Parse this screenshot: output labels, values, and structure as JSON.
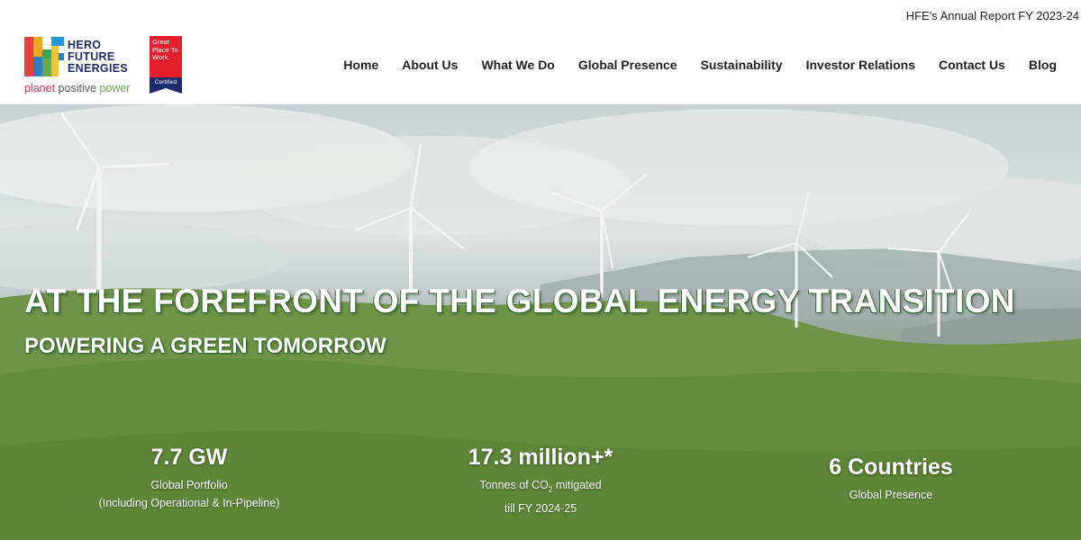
{
  "topbar": {
    "annual_report": "HFE's Annual Report FY 2023-24"
  },
  "logo": {
    "line1": "HERO",
    "line2": "FUTURE",
    "line3": "ENERGIES",
    "reg": "®",
    "tagline_w1": "planet",
    "tagline_w2": "positive",
    "tagline_w3": "power"
  },
  "badge": {
    "text": "Great Place To Work.",
    "certified": "Certified"
  },
  "nav": [
    "Home",
    "About Us",
    "What We Do",
    "Global Presence",
    "Sustainability",
    "Investor Relations",
    "Contact Us",
    "Blog"
  ],
  "hero": {
    "headline": "AT THE FOREFRONT OF THE GLOBAL ENERGY TRANSITION",
    "subline": "POWERING A GREEN TOMORROW"
  },
  "stats": [
    {
      "value": "7.7 GW",
      "label1": "Global Portfolio",
      "label2": "(Including Operational & In-Pipeline)"
    },
    {
      "value": "17.3 million+*",
      "label1_a": "Tonnes of CO",
      "label1_sub": "2",
      "label1_b": " mitigated",
      "label2": "till FY 2024-25"
    },
    {
      "value": "6 Countries",
      "label1": "Global Presence"
    }
  ],
  "colors": {
    "brand_navy": "#1f2a6b",
    "badge_red": "#e41e2b",
    "headline_outline": "#2e6b2c"
  }
}
